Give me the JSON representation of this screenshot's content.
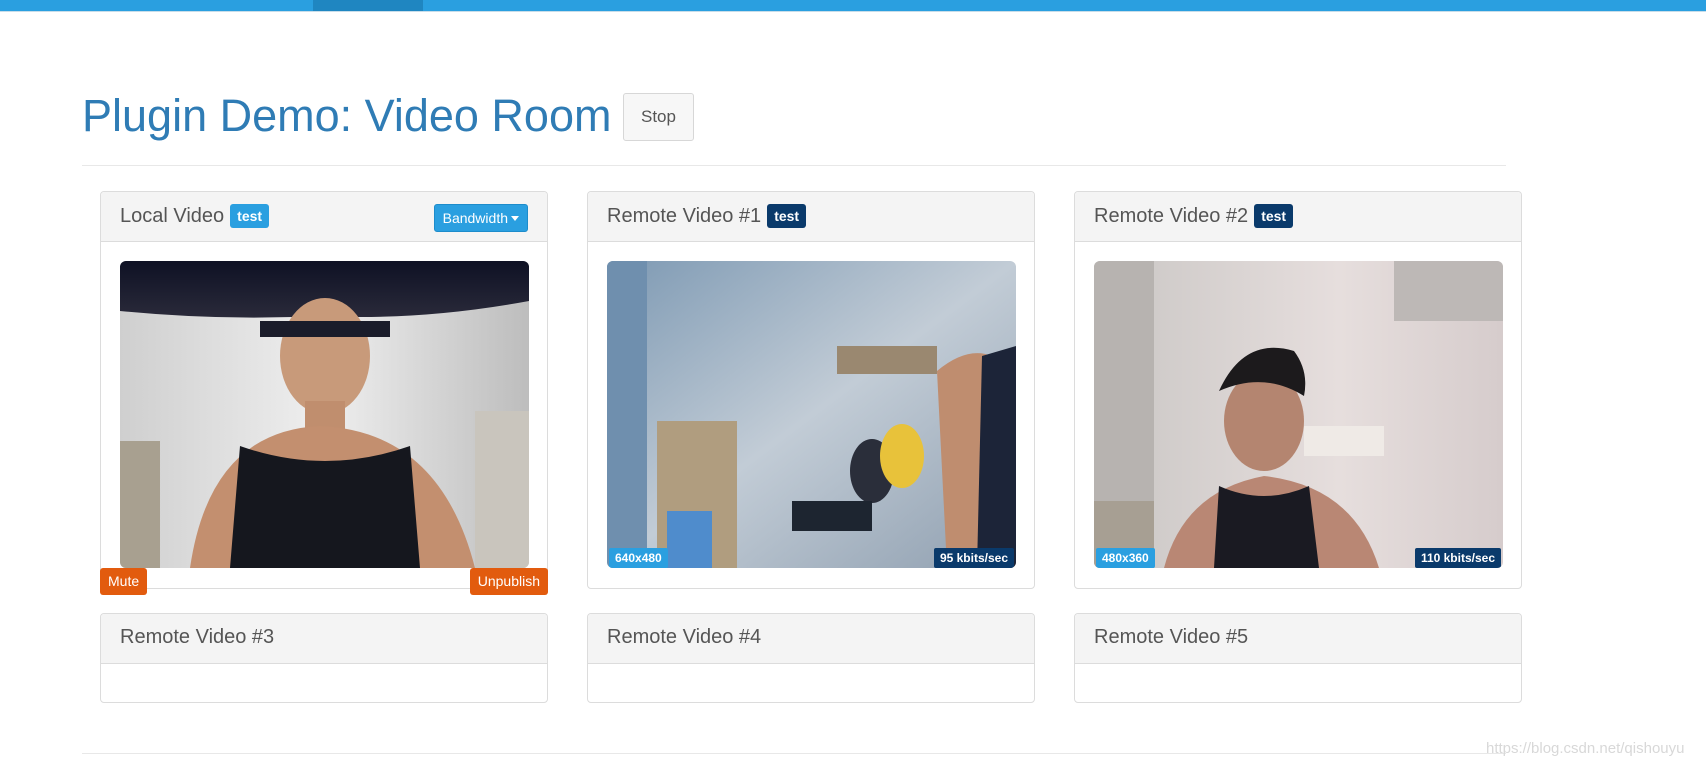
{
  "header": {
    "title": "Plugin Demo: Video Room",
    "stop_label": "Stop"
  },
  "local": {
    "title": "Local Video",
    "badge": "test",
    "bandwidth_label": "Bandwidth",
    "mute_label": "Mute",
    "unpublish_label": "Unpublish"
  },
  "remotes": [
    {
      "title": "Remote Video #1",
      "badge": "test",
      "resolution": "640x480",
      "bitrate": "95 kbits/sec"
    },
    {
      "title": "Remote Video #2",
      "badge": "test",
      "resolution": "480x360",
      "bitrate": "110 kbits/sec"
    },
    {
      "title": "Remote Video #3"
    },
    {
      "title": "Remote Video #4"
    },
    {
      "title": "Remote Video #5"
    }
  ],
  "watermark": "https://blog.csdn.net/qishouyu",
  "colors": {
    "topbar": "#2a9fe0",
    "title": "#2f7cb5",
    "badge_light": "#2a9fe0",
    "badge_dark": "#0a3a6b",
    "danger_button": "#e25b0e"
  },
  "icons": {
    "bandwidth_dropdown": "caret-down-icon"
  }
}
